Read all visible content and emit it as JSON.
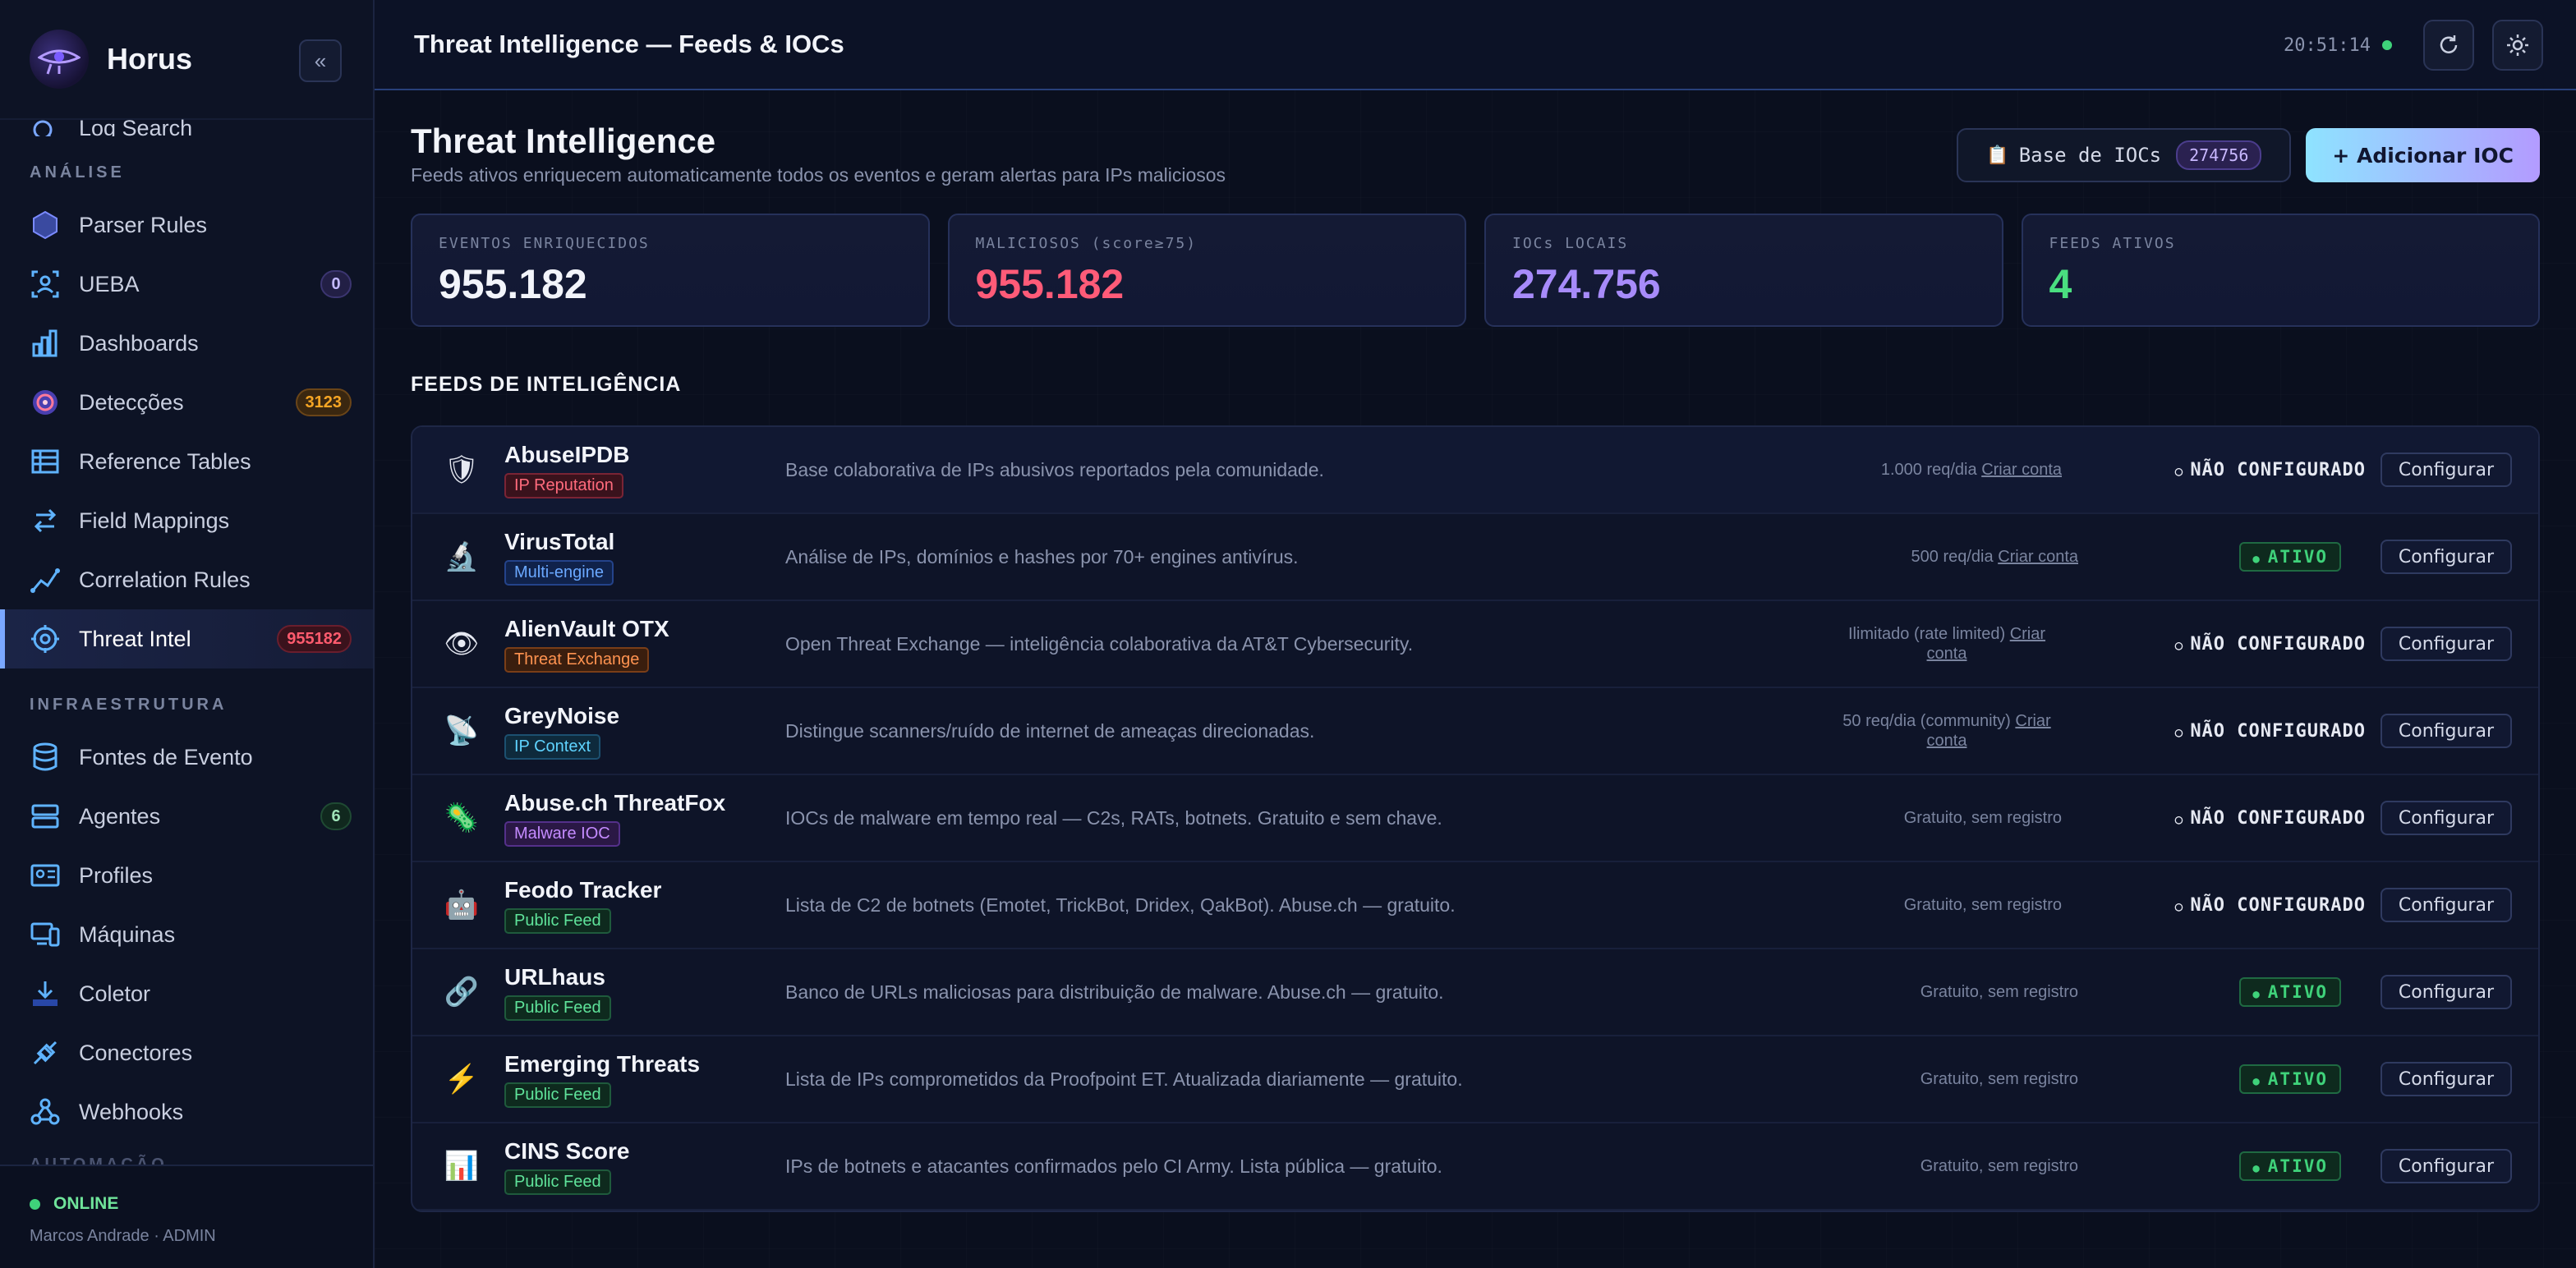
{
  "brand": {
    "name": "Horus"
  },
  "sidebar": {
    "partial_top": "Log Search",
    "sections": [
      {
        "title": "ANÁLISE",
        "items": [
          {
            "label": "Parser Rules",
            "icon": "hexagon-icon",
            "badge": null
          },
          {
            "label": "UEBA",
            "icon": "user-scan-icon",
            "badge": "0",
            "badge_color": "purple"
          },
          {
            "label": "Dashboards",
            "icon": "bar-chart-icon",
            "badge": null
          },
          {
            "label": "Detecções",
            "icon": "target-icon",
            "badge": "3123",
            "badge_color": "orange"
          },
          {
            "label": "Reference Tables",
            "icon": "table-icon",
            "badge": null
          },
          {
            "label": "Field Mappings",
            "icon": "arrows-icon",
            "badge": null
          },
          {
            "label": "Correlation Rules",
            "icon": "trend-icon",
            "badge": null
          },
          {
            "label": "Threat Intel",
            "icon": "radar-icon",
            "badge": "955182",
            "badge_color": "red",
            "active": true
          }
        ]
      },
      {
        "title": "INFRAESTRUTURA",
        "items": [
          {
            "label": "Fontes de Evento",
            "icon": "database-icon",
            "badge": null
          },
          {
            "label": "Agentes",
            "icon": "server-icon",
            "badge": "6",
            "badge_color": "green"
          },
          {
            "label": "Profiles",
            "icon": "id-card-icon",
            "badge": null
          },
          {
            "label": "Máquinas",
            "icon": "devices-icon",
            "badge": null
          },
          {
            "label": "Coletor",
            "icon": "download-icon",
            "badge": null
          },
          {
            "label": "Conectores",
            "icon": "plug-icon",
            "badge": null
          },
          {
            "label": "Webhooks",
            "icon": "webhook-icon",
            "badge": null
          }
        ]
      }
    ],
    "faded_section": "AUTOMAÇÃO",
    "footer": {
      "status": "ONLINE",
      "user": "Marcos Andrade · ADMIN"
    }
  },
  "topbar": {
    "title": "Threat Intelligence — Feeds & IOCs",
    "clock": "20:51:14"
  },
  "page": {
    "title": "Threat Intelligence",
    "subtitle": "Feeds ativos enriquecem automaticamente todos os eventos e geram alertas para IPs maliciosos",
    "ioc_base_label": "Base de IOCs",
    "ioc_base_count": "274756",
    "add_ioc_label": "+ Adicionar IOC"
  },
  "stats": [
    {
      "label": "EVENTOS ENRIQUECIDOS",
      "value": "955.182",
      "color": "#f2f4fa"
    },
    {
      "label": "MALICIOSOS (score≥75)",
      "value": "955.182",
      "color": "#ff5b78"
    },
    {
      "label": "IOCs LOCAIS",
      "value": "274.756",
      "color": "#a78bfa"
    },
    {
      "label": "FEEDS ATIVOS",
      "value": "4",
      "color": "#4ade80"
    }
  ],
  "feeds_title": "FEEDS DE INTELIGÊNCIA",
  "feeds": [
    {
      "name": "AbuseIPDB",
      "tag": "IP Reputation",
      "tag_color": "red",
      "icon": "shield-icon",
      "glyph": "🛡",
      "desc": "Base colaborativa de IPs abusivos reportados pela comunidade.",
      "limit": "1.000 req/dia",
      "link": "Criar conta",
      "status": "NÃO CONFIGURADO",
      "active": false
    },
    {
      "name": "VirusTotal",
      "tag": "Multi-engine",
      "tag_color": "blue",
      "icon": "microscope-icon",
      "glyph": "🔬",
      "desc": "Análise de IPs, domínios e hashes por 70+ engines antivírus.",
      "limit": "500 req/dia",
      "link": "Criar conta",
      "status": "ATIVO",
      "active": true
    },
    {
      "name": "AlienVault OTX",
      "tag": "Threat Exchange",
      "tag_color": "orange",
      "icon": "eye-icon",
      "glyph": "👁",
      "desc": "Open Threat Exchange — inteligência colaborativa da AT&T Cybersecurity.",
      "limit": "Ilimitado (rate limited)",
      "link": "Criar conta",
      "status": "NÃO CONFIGURADO",
      "active": false
    },
    {
      "name": "GreyNoise",
      "tag": "IP Context",
      "tag_color": "cyan",
      "icon": "satellite-icon",
      "glyph": "📡",
      "desc": "Distingue scanners/ruído de internet de ameaças direcionadas.",
      "limit": "50 req/dia (community)",
      "link": "Criar conta",
      "status": "NÃO CONFIGURADO",
      "active": false
    },
    {
      "name": "Abuse.ch ThreatFox",
      "tag": "Malware IOC",
      "tag_color": "purple",
      "icon": "virus-icon",
      "glyph": "🦠",
      "desc": "IOCs de malware em tempo real — C2s, RATs, botnets. Gratuito e sem chave.",
      "limit": "Gratuito, sem registro",
      "link": "",
      "status": "NÃO CONFIGURADO",
      "active": false
    },
    {
      "name": "Feodo Tracker",
      "tag": "Public Feed",
      "tag_color": "green",
      "icon": "robot-icon",
      "glyph": "🤖",
      "desc": "Lista de C2 de botnets (Emotet, TrickBot, Dridex, QakBot). Abuse.ch — gratuito.",
      "limit": "Gratuito, sem registro",
      "link": "",
      "status": "NÃO CONFIGURADO",
      "active": false
    },
    {
      "name": "URLhaus",
      "tag": "Public Feed",
      "tag_color": "green",
      "icon": "link-icon",
      "glyph": "🔗",
      "desc": "Banco de URLs maliciosas para distribuição de malware. Abuse.ch — gratuito.",
      "limit": "Gratuito, sem registro",
      "link": "",
      "status": "ATIVO",
      "active": true
    },
    {
      "name": "Emerging Threats",
      "tag": "Public Feed",
      "tag_color": "green",
      "icon": "lightning-icon",
      "glyph": "⚡",
      "desc": "Lista de IPs comprometidos da Proofpoint ET. Atualizada diariamente — gratuito.",
      "limit": "Gratuito, sem registro",
      "link": "",
      "status": "ATIVO",
      "active": true
    },
    {
      "name": "CINS Score",
      "tag": "Public Feed",
      "tag_color": "green",
      "icon": "chart-icon",
      "glyph": "📊",
      "desc": "IPs de botnets e atacantes confirmados pelo CI Army. Lista pública — gratuito.",
      "limit": "Gratuito, sem registro",
      "link": "",
      "status": "ATIVO",
      "active": true
    }
  ],
  "configure_label": "Configurar"
}
